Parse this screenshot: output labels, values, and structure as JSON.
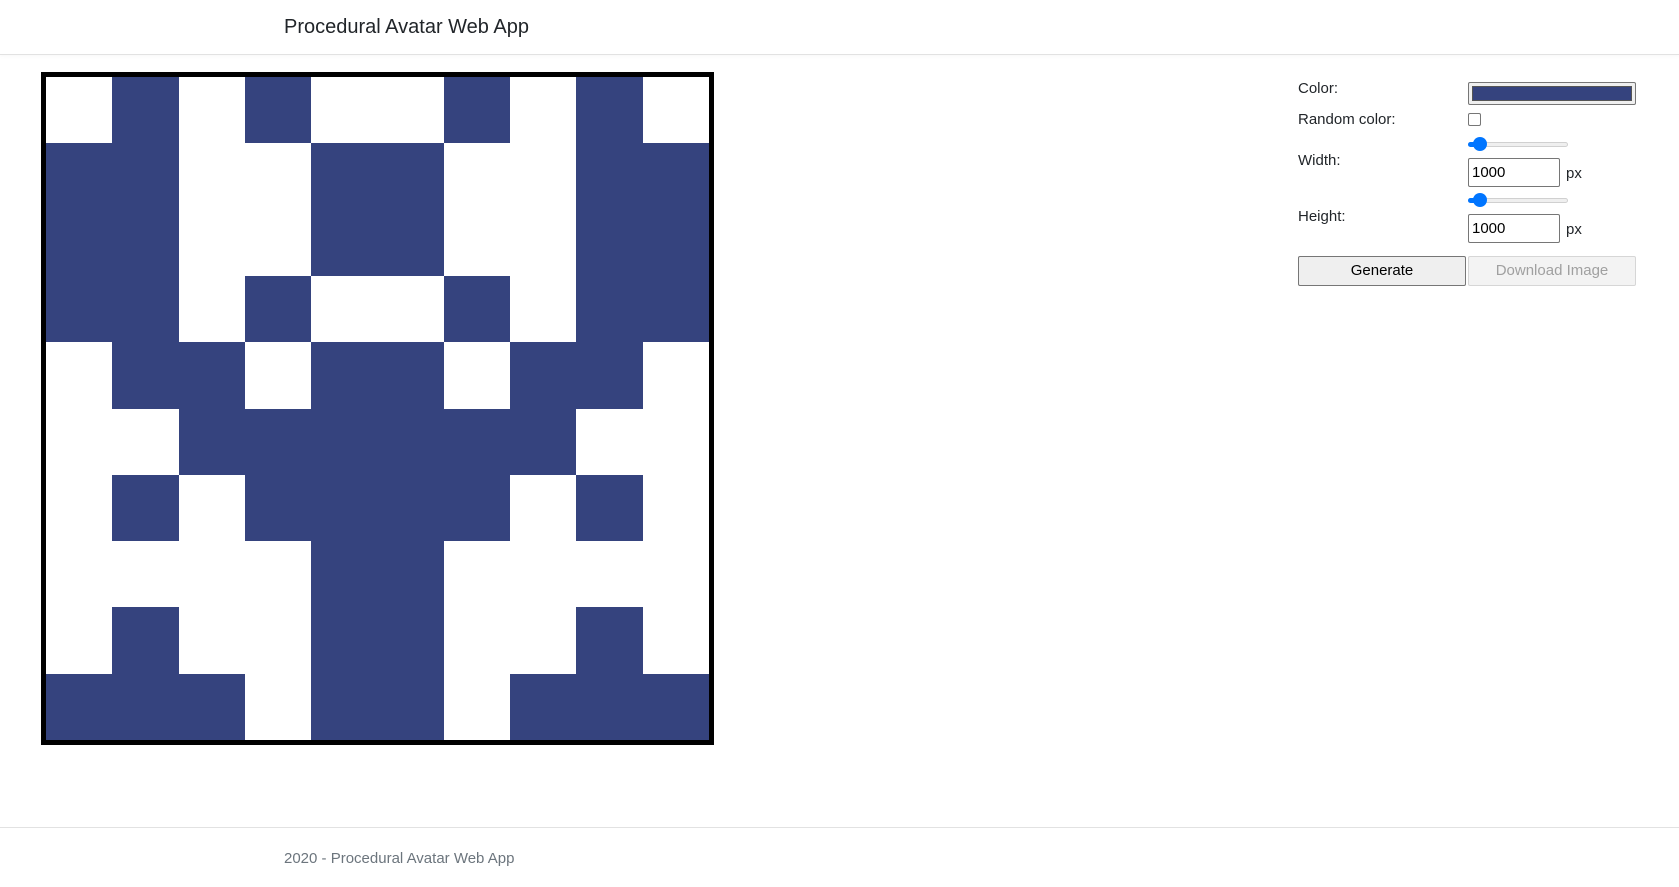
{
  "header": {
    "brand": "Procedural Avatar Web App"
  },
  "avatar": {
    "color": "#35437e",
    "background": "#ffffff",
    "rows": [
      "0101001010",
      "1100110011",
      "1100110011",
      "1101001011",
      "0110110110",
      "0011111100",
      "0101111010",
      "0000110000",
      "0100110010",
      "1110110111"
    ]
  },
  "controls": {
    "color_label": "Color:",
    "color_value": "#35437e",
    "random_color_label": "Random color:",
    "random_color_checked": false,
    "width_label": "Width:",
    "width_value": "1000",
    "width_slider_fraction": 0.12,
    "height_label": "Height:",
    "height_value": "1000",
    "height_slider_fraction": 0.12,
    "unit": "px",
    "generate_label": "Generate",
    "download_label": "Download Image"
  },
  "footer": {
    "text": "2020 - Procedural Avatar Web App"
  }
}
